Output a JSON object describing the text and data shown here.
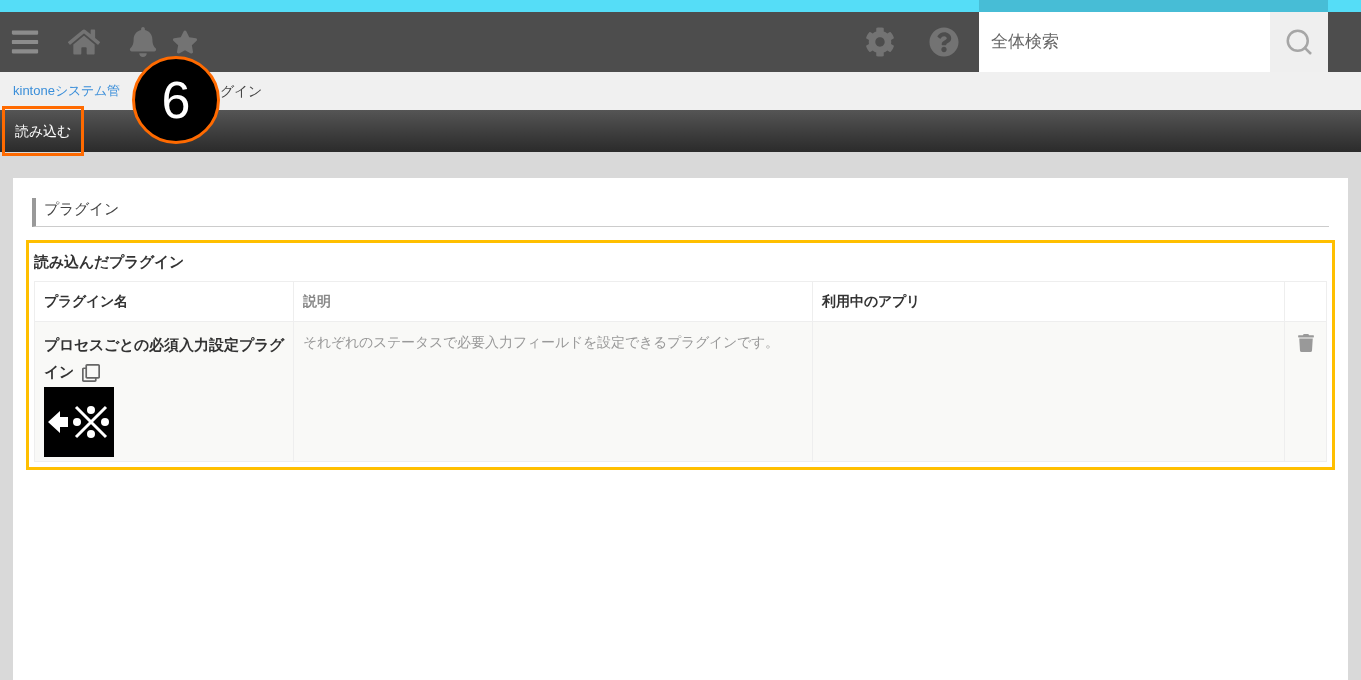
{
  "search": {
    "placeholder": "全体検索"
  },
  "breadcrumb": [
    "kintoneシステム管",
    "グイン"
  ],
  "callout": {
    "number": "6"
  },
  "toolbar": {
    "buttons": [
      {
        "label": "読み込む",
        "highlighted": true
      }
    ]
  },
  "section": {
    "title": "プラグイン"
  },
  "plugins": {
    "title": "読み込んだプラグイン",
    "highlighted": true,
    "columns": [
      "プラグイン名",
      "説明",
      "利用中のアプリ"
    ],
    "rows": [
      {
        "name": "プロセスごとの必須入力設定プラグイン",
        "description": "それぞれのステータスで必要入力フィールドを設定できるプラグインです。"
      }
    ]
  }
}
